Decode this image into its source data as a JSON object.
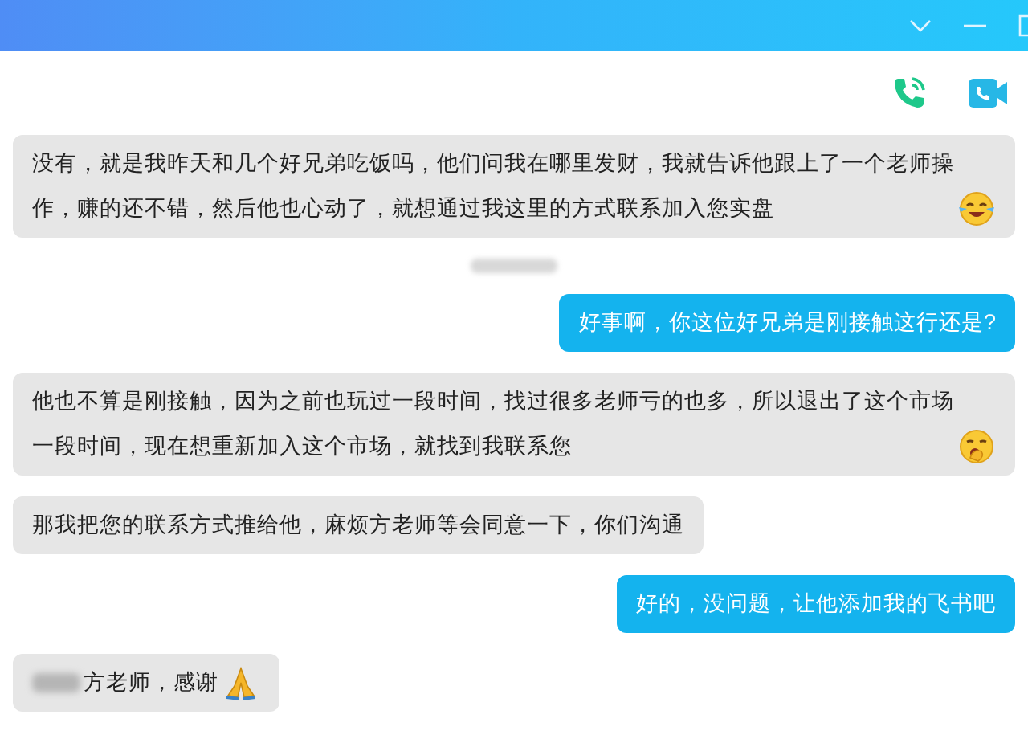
{
  "messages": [
    {
      "kind": "incoming",
      "text": "没有，就是我昨天和几个好兄弟吃饭吗，他们问我在哪里发财，我就告诉他跟上了一个老师操作，赚的还不错，然后他也心动了，就想通过我这里的方式联系加入您实盘",
      "emoji": {
        "kind": "laugh-cry"
      },
      "redacted_prefix": false
    },
    {
      "kind": "timestamp"
    },
    {
      "kind": "outgoing",
      "text": "好事啊，你这位好兄弟是刚接触这行还是?",
      "redacted_prefix": false
    },
    {
      "kind": "incoming",
      "text": "他也不算是刚接触，因为之前也玩过一段时间，找过很多老师亏的也多，所以退出了这个市场一段时间，现在想重新加入这个市场，就找到我联系您",
      "emoji": {
        "kind": "yawn"
      },
      "redacted_prefix": false
    },
    {
      "kind": "incoming",
      "text": "那我把您的联系方式推给他，麻烦方老师等会同意一下，你们沟通",
      "redacted_prefix": false
    },
    {
      "kind": "outgoing",
      "text": "好的，没问题，让他添加我的飞书吧",
      "redacted_prefix": false
    },
    {
      "kind": "incoming",
      "text": "方老师，感谢",
      "emoji": {
        "kind": "pray"
      },
      "redacted_prefix": true
    }
  ]
}
